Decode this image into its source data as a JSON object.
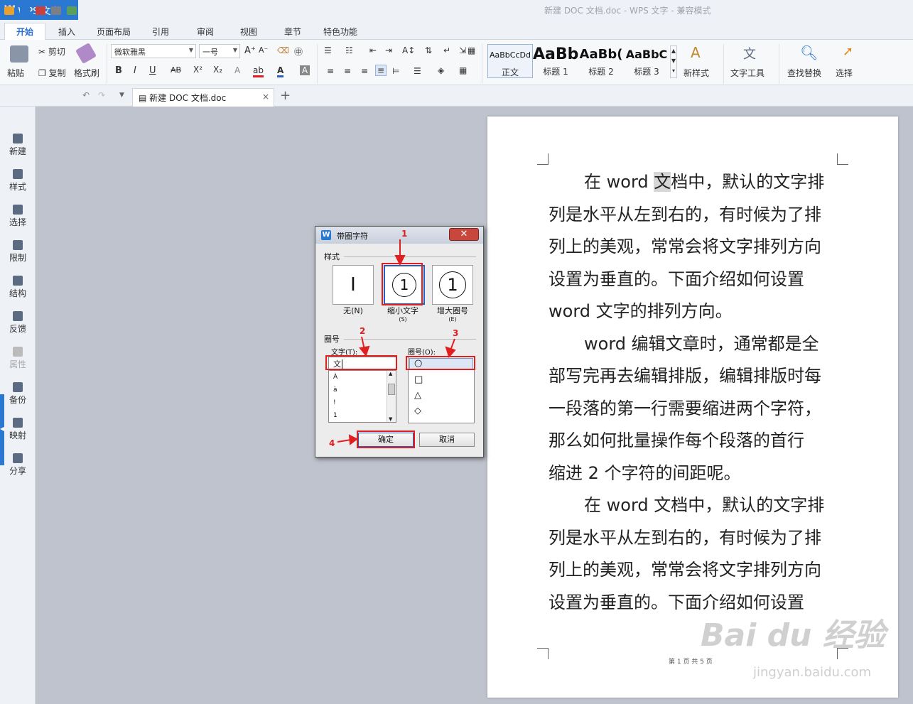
{
  "app": {
    "name": "WPS 文字",
    "window_title": "新建 DOC 文档.doc - WPS 文字 - 兼容模式"
  },
  "menu_tabs": [
    "开始",
    "插入",
    "页面布局",
    "引用",
    "审阅",
    "视图",
    "章节",
    "特色功能"
  ],
  "ribbon": {
    "paste": "粘贴",
    "cut": "剪切",
    "copy": "复制",
    "format_painter": "格式刷",
    "font_name": "微软雅黑",
    "font_size": "一号",
    "styles": [
      {
        "preview": "AaBbCcDd",
        "label": "正文"
      },
      {
        "preview": "AaBb",
        "label": "标题 1"
      },
      {
        "preview": "AaBb(",
        "label": "标题 2"
      },
      {
        "preview": "AaBbC",
        "label": "标题 3"
      }
    ],
    "new_style": "新样式",
    "text_tools": "文字工具",
    "find_replace": "查找替换",
    "select": "选择"
  },
  "doc_tab": {
    "name": "新建 DOC 文档.doc"
  },
  "sidebar": [
    {
      "label": "新建",
      "icon": "new-doc-icon",
      "disabled": false
    },
    {
      "label": "样式",
      "icon": "style-icon",
      "disabled": false
    },
    {
      "label": "选择",
      "icon": "select-icon",
      "disabled": false
    },
    {
      "label": "限制",
      "icon": "restrict-icon",
      "disabled": false
    },
    {
      "label": "结构",
      "icon": "structure-icon",
      "disabled": false
    },
    {
      "label": "反馈",
      "icon": "feedback-icon",
      "disabled": false
    },
    {
      "label": "属性",
      "icon": "properties-icon",
      "disabled": true
    },
    {
      "label": "备份",
      "icon": "backup-icon",
      "disabled": false
    },
    {
      "label": "映射",
      "icon": "mapping-icon",
      "disabled": false
    },
    {
      "label": "分享",
      "icon": "share-icon",
      "disabled": false
    }
  ],
  "document": {
    "paragraphs": [
      {
        "lines": [
          "在 word ",
          "文",
          "档中，默认的文字排",
          "列是水平从左到右的，有时候为了排",
          "列上的美观，常常会将文字排列方向",
          "设置为垂直的。下面介绍如何设置",
          "word 文字的排列方向。"
        ]
      },
      {
        "lines": [
          "word 编辑文章时，通常都是全",
          "部写完再去编辑排版，编辑排版时每",
          "一段落的第一行需要缩进两个字符，",
          "那么如何批量操作每个段落的首行",
          "缩进 2 个字符的间距呢。"
        ]
      },
      {
        "lines": [
          "在 word 文档中，默认的文字排",
          "列是水平从左到右的，有时候为了排",
          "列上的美观，常常会将文字排列方向",
          "设置为垂直的。下面介绍如何设置"
        ]
      }
    ],
    "footer": "第 1 页 共 5 页"
  },
  "dialog": {
    "title": "带圈字符",
    "style_section": "样式",
    "styles": [
      {
        "label": "无",
        "key": "(N)",
        "glyph": "I"
      },
      {
        "label": "缩小文字",
        "key": "(S)",
        "glyph": "1"
      },
      {
        "label": "增大圈号",
        "key": "(E)",
        "glyph": "1"
      }
    ],
    "enclosure_section": "圈号",
    "text_label": "文字(T):",
    "text_value": "文",
    "text_list": [
      "À",
      "à",
      "!",
      "1"
    ],
    "circle_label": "圈号(O):",
    "circle_options": [
      "○",
      "□",
      "△",
      "◇"
    ],
    "ok": "确定",
    "cancel": "取消"
  },
  "annotations": [
    "1",
    "2",
    "3",
    "4"
  ],
  "watermark": {
    "brand": "Bai du 经验",
    "url": "jingyan.baidu.com"
  },
  "colors": {
    "accent": "#2b78d2",
    "annotation": "#e02020"
  }
}
